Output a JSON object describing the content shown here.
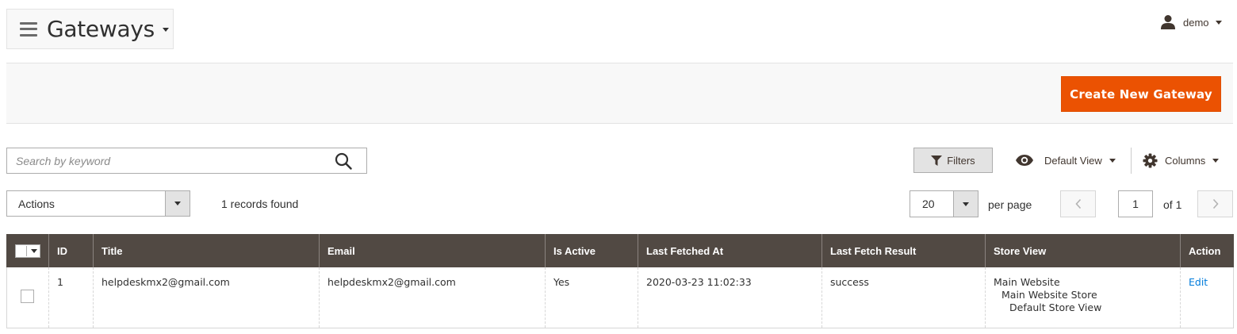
{
  "header": {
    "title": "Gateways",
    "user_name": "demo"
  },
  "action_bar": {
    "create_button_label": "Create New Gateway",
    "button_color": "#eb5202"
  },
  "toolbar": {
    "search_placeholder": "Search by keyword",
    "search_value": "",
    "filters_label": "Filters",
    "view_label": "Default View",
    "columns_label": "Columns"
  },
  "mass_actions": {
    "selected": "Actions"
  },
  "records_found": "1 records found",
  "pagination": {
    "per_page_value": "20",
    "per_page_label": "per page",
    "current_page": "1",
    "total_label": "of 1"
  },
  "grid": {
    "header_color": "#514943",
    "columns": [
      "ID",
      "Title",
      "Email",
      "Is Active",
      "Last Fetched At",
      "Last Fetch Result",
      "Store View",
      "Action"
    ],
    "rows": [
      {
        "id": "1",
        "title": "helpdeskmx2@gmail.com",
        "email": "helpdeskmx2@gmail.com",
        "is_active": "Yes",
        "last_fetched_at": "2020-03-23 11:02:33",
        "last_fetch_result": "success",
        "store_view": [
          "Main Website",
          "Main Website Store",
          "Default Store View"
        ],
        "action": "Edit"
      }
    ]
  },
  "icons": {
    "menu": "hamburger-icon",
    "user": "user-icon",
    "search": "search-icon",
    "filter": "filter-icon",
    "view": "eye-icon",
    "columns": "gear-icon",
    "prev": "chevron-left-icon",
    "next": "chevron-right-icon"
  }
}
